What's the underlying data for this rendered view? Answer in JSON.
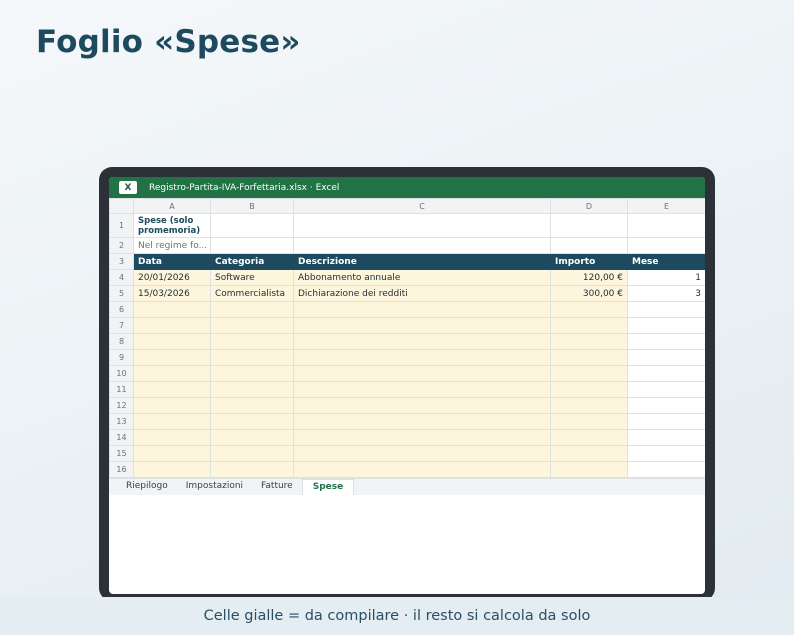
{
  "page": {
    "title": "Foglio «Spese»"
  },
  "window": {
    "icon_letter": "X",
    "title": "Registro-Partita-IVA-Forfettaria.xlsx · Excel"
  },
  "columns": [
    "A",
    "B",
    "C",
    "D",
    "E"
  ],
  "sheet": {
    "title_cell": "Spese (solo promemoria)",
    "note_cell": "Nel regime fo...",
    "headers": [
      "Data",
      "Categoria",
      "Descrizione",
      "Importo",
      "Mese"
    ],
    "rows": [
      [
        "20/01/2026",
        "Software",
        "Abbonamento annuale",
        "120,00 €",
        "1"
      ],
      [
        "15/03/2026",
        "Commercialista",
        "Dichiarazione dei redditi",
        "300,00 €",
        "3"
      ]
    ],
    "row_numbers": [
      "1",
      "2",
      "3",
      "4",
      "5",
      "6",
      "7",
      "8",
      "9",
      "10",
      "11",
      "12",
      "13",
      "14",
      "15",
      "16"
    ]
  },
  "tabs": [
    "Riepilogo",
    "Impostazioni",
    "Fatture",
    "Spese"
  ],
  "active_tab": "Spese",
  "footer": {
    "text": "Celle gialle = da compilare · il resto si calcola da solo"
  },
  "colors": {
    "brand": "#217346",
    "header": "#1d4a5e",
    "input_cell": "#fdf6dc"
  }
}
